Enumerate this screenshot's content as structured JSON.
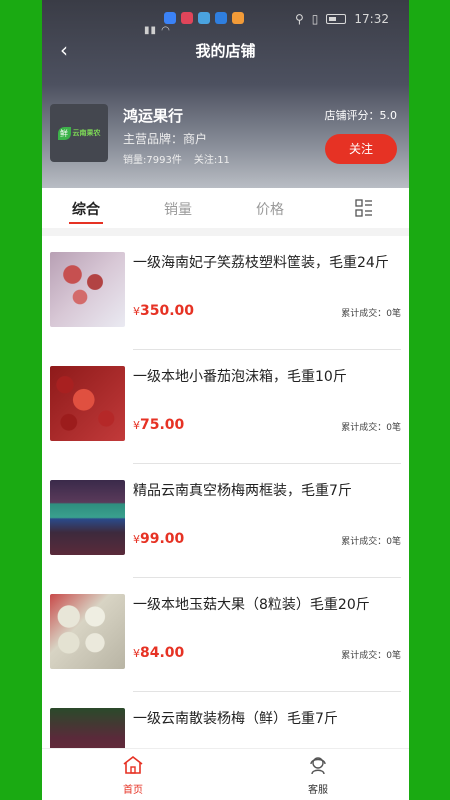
{
  "status_bar": {
    "time": "17:32"
  },
  "header": {
    "title": "我的店铺"
  },
  "shop": {
    "name": "鸿运果行",
    "brand": "主营品牌：商户",
    "sales": "销量:7993件",
    "followers": "关注:11",
    "rating": "店铺评分：5.0",
    "follow_label": "关注",
    "logo_text": "云南果农"
  },
  "tabs": [
    {
      "label": "综合"
    },
    {
      "label": "销量"
    },
    {
      "label": "价格"
    }
  ],
  "products": [
    {
      "title": "一级海南妃子笑荔枝塑料筐装，毛重24斤",
      "price": "350.00",
      "sold": "累计成交：0笔"
    },
    {
      "title": "一级本地小番茄泡沫箱，毛重10斤",
      "price": "75.00",
      "sold": "累计成交：0笔"
    },
    {
      "title": "精品云南真空杨梅两框装，毛重7斤",
      "price": "99.00",
      "sold": "累计成交：0笔"
    },
    {
      "title": "一级本地玉菇大果（8粒装）毛重20斤",
      "price": "84.00",
      "sold": "累计成交：0笔"
    },
    {
      "title": "一级云南散装杨梅（鲜）毛重7斤",
      "price": "",
      "sold": ""
    }
  ],
  "currency": "¥",
  "bottom_nav": [
    {
      "label": "首页",
      "icon": "home-icon"
    },
    {
      "label": "客服",
      "icon": "customer-service-icon"
    }
  ],
  "colors": {
    "accent": "#e63224",
    "background": "#1aaa12"
  }
}
